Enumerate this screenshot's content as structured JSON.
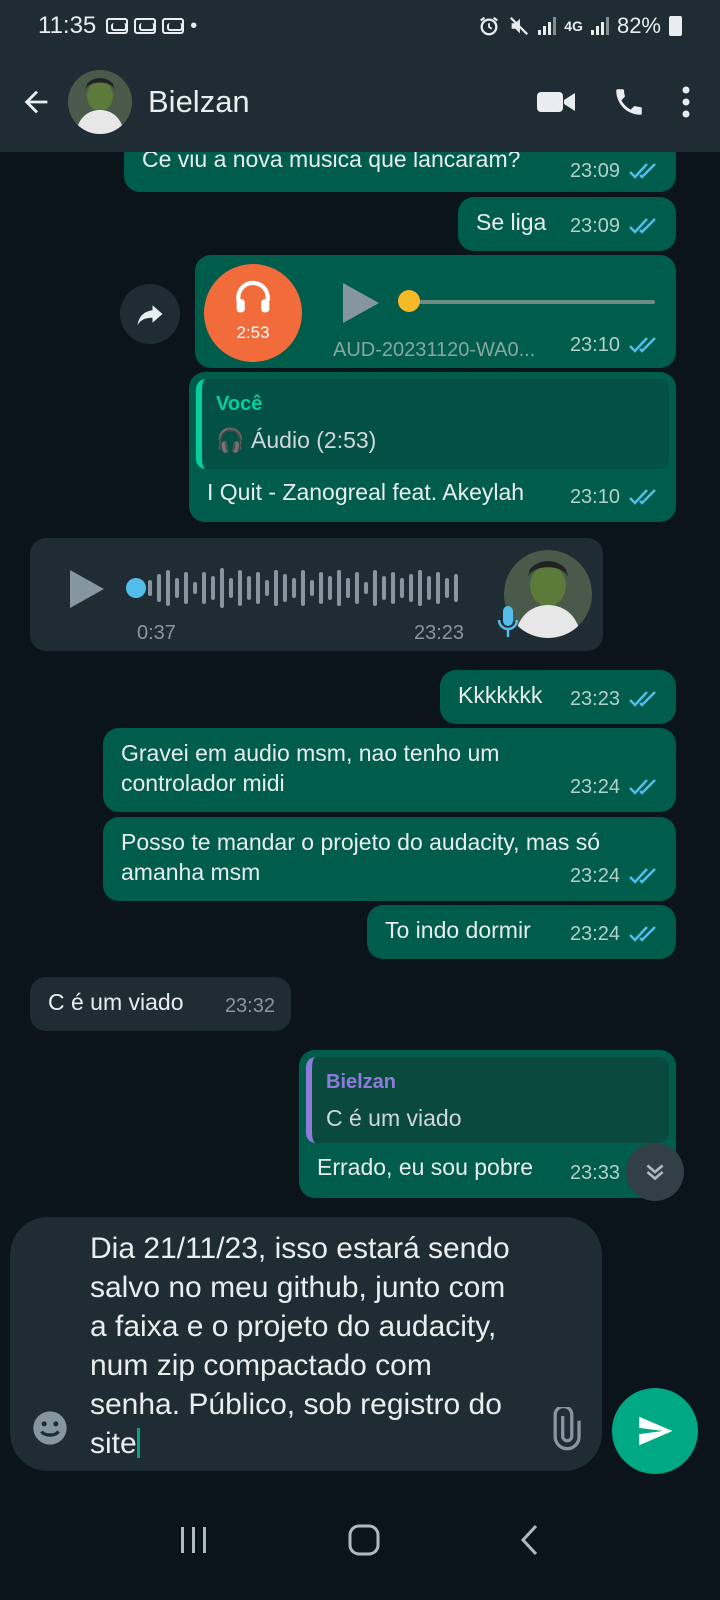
{
  "status_bar": {
    "time": "11:35",
    "battery": "82%",
    "network": "4G"
  },
  "header": {
    "contact_name": "Bielzan"
  },
  "messages": [
    {
      "text": "Ce viu a nova musica que lancaram?",
      "time": "23:09"
    },
    {
      "text": "Se liga",
      "time": "23:09"
    },
    {
      "audio_duration": "2:53",
      "filename": "AUD-20231120-WA0...",
      "time": "23:10"
    },
    {
      "quote_author": "Você",
      "quote_text": "Áudio (2:53)",
      "text": "I Quit - Zanogreal feat. Akeylah",
      "time": "23:10"
    },
    {
      "elapsed": "0:37",
      "time": "23:23"
    },
    {
      "text": "Kkkkkkk",
      "time": "23:23"
    },
    {
      "text": "Gravei em audio msm, nao tenho um controlador midi",
      "time": "23:24"
    },
    {
      "text": "Posso te mandar o projeto do audacity, mas só amanha msm",
      "time": "23:24"
    },
    {
      "text": "To indo dormir",
      "time": "23:24"
    },
    {
      "text": "C é um viado",
      "time": "23:32"
    },
    {
      "quote_author": "Bielzan",
      "quote_text": "C é um viado",
      "text": "Errado, eu sou pobre",
      "time": "23:33"
    }
  ],
  "composer": {
    "text": "Dia 21/11/23, isso estará sendo salvo no meu github, junto com a faixa e o projeto do audacity, num zip compactado com senha. Público, sob registro do site"
  },
  "colors": {
    "outgoing": "#005c4b",
    "incoming": "#202c33",
    "accent": "#00a884",
    "tick": "#53bdeb"
  }
}
